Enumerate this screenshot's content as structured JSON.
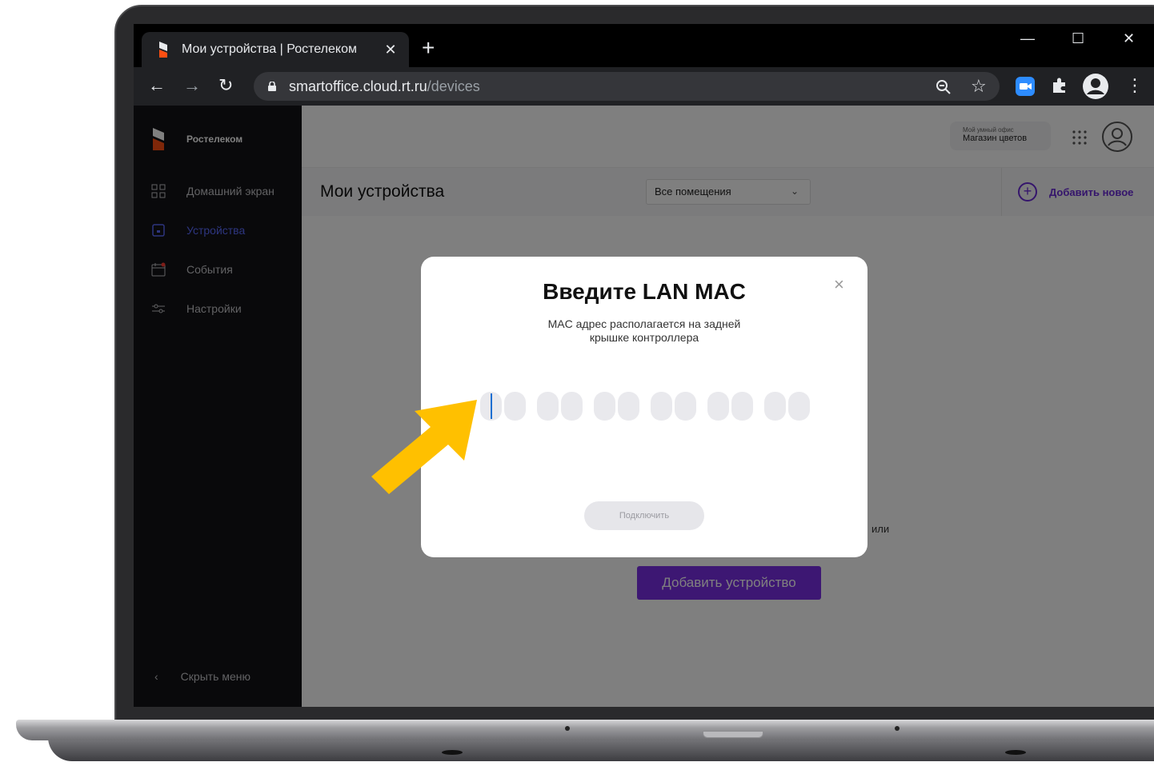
{
  "browser": {
    "tab_title": "Мои устройства | Ростелеком",
    "tab_close": "✕",
    "new_tab": "+",
    "url_host": "smartoffice.cloud.rt.ru",
    "url_path": "/devices",
    "window_controls": {
      "minimize": "—",
      "maximize": "☐",
      "close": "✕"
    }
  },
  "sidebar": {
    "brand": "Ростелеком",
    "items": [
      {
        "label": "Домашний экран",
        "icon": "home-grid-icon",
        "active": false
      },
      {
        "label": "Устройства",
        "icon": "device-icon",
        "active": true
      },
      {
        "label": "События",
        "icon": "calendar-icon",
        "active": false
      },
      {
        "label": "Настройки",
        "icon": "settings-sliders-icon",
        "active": false
      }
    ],
    "hide_menu": "Скрыть меню"
  },
  "header": {
    "office_label": "Мой умный офис",
    "office_name": "Магазин цветов"
  },
  "page": {
    "title": "Мои устройства",
    "room_select": "Все помещения",
    "add_new": "Добавить новое",
    "or_text": "или",
    "add_device_button": "Добавить устройство"
  },
  "modal": {
    "title": "Введите LAN MAC",
    "subtitle": "MAC адрес располагается на задней крышке контроллера",
    "close": "×",
    "connect_button": "Подключить",
    "mac_cell_count": 12
  },
  "colors": {
    "accent": "#7b2fe6",
    "active_nav": "#5a6bff",
    "pointer_arrow": "#ffc000"
  }
}
